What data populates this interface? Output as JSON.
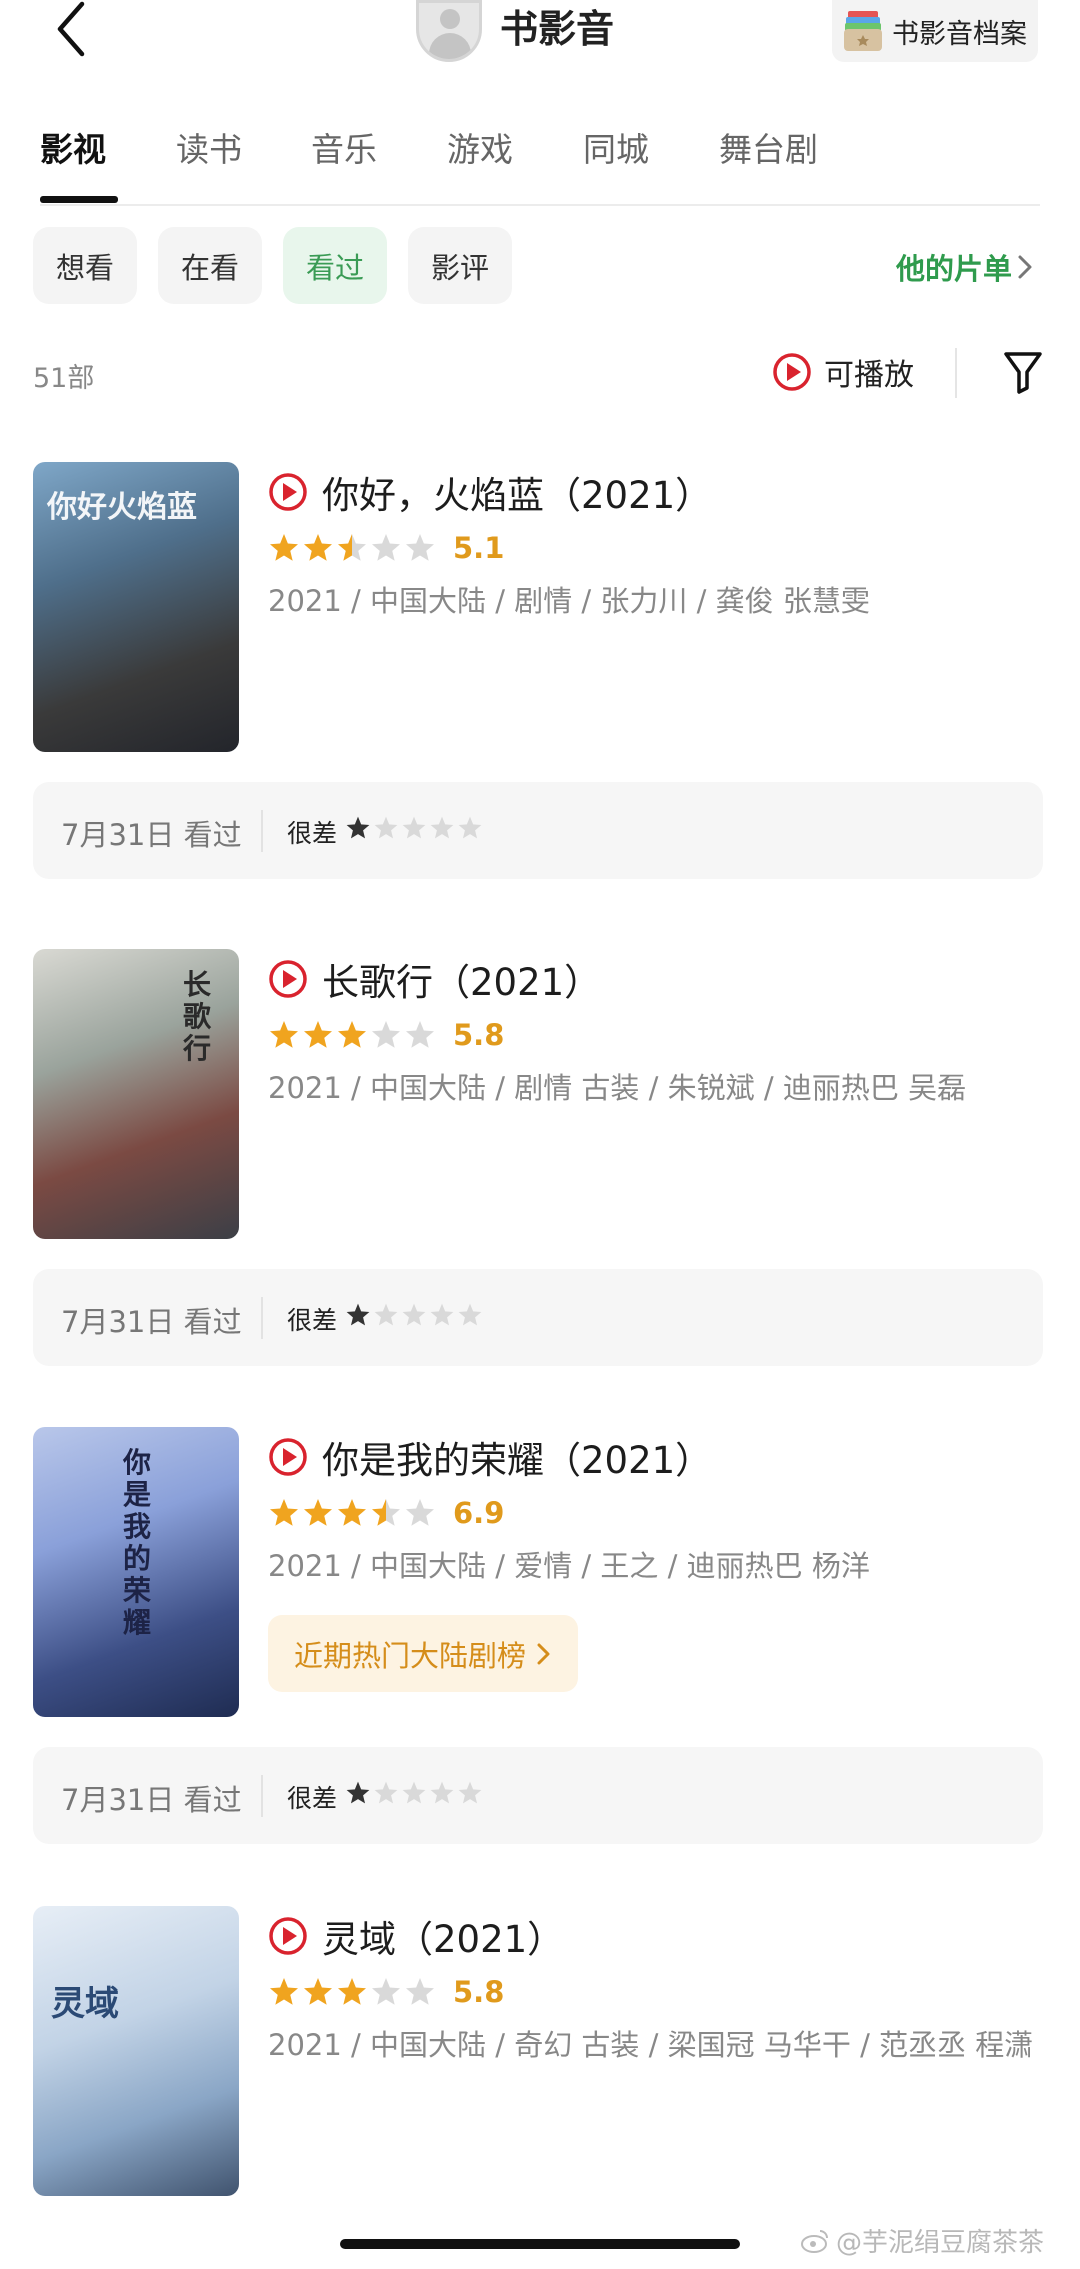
{
  "header": {
    "title": "书影音",
    "archive_label": "书影音档案"
  },
  "tabs": [
    {
      "label": "影视",
      "active": true
    },
    {
      "label": "读书",
      "active": false
    },
    {
      "label": "音乐",
      "active": false
    },
    {
      "label": "游戏",
      "active": false
    },
    {
      "label": "同城",
      "active": false
    },
    {
      "label": "舞台剧",
      "active": false
    }
  ],
  "filters": [
    {
      "label": "想看",
      "active": false
    },
    {
      "label": "在看",
      "active": false
    },
    {
      "label": "看过",
      "active": true
    },
    {
      "label": "影评",
      "active": false
    }
  ],
  "my_list_label": "他的片单",
  "count_label": "51部",
  "playable_label": "可播放",
  "colors": {
    "accent_green": "#2f9b4d",
    "star_gold": "#f0a41f",
    "play_red": "#d9232e",
    "hot_badge": "#d58d1a"
  },
  "items": [
    {
      "title": "你好，火焰蓝（2021）",
      "poster_text": "你好火焰蓝",
      "rating": 5.1,
      "rating_label": "5.1",
      "stars": 2.5,
      "meta": "2021 / 中国大陆 / 剧情 / 张力川 / 龚俊 张慧雯",
      "hot_badge": "",
      "review_date": "7月31日 看过",
      "review_verdict": "很差",
      "my_stars": 1
    },
    {
      "title": "长歌行（2021）",
      "poster_text": "长歌行",
      "rating": 5.8,
      "rating_label": "5.8",
      "stars": 3,
      "meta": "2021 / 中国大陆 / 剧情 古装 / 朱锐斌 / 迪丽热巴 吴磊",
      "hot_badge": "",
      "review_date": "7月31日 看过",
      "review_verdict": "很差",
      "my_stars": 1
    },
    {
      "title": "你是我的荣耀（2021）",
      "poster_text": "你是我的荣耀",
      "rating": 6.9,
      "rating_label": "6.9",
      "stars": 3.5,
      "meta": "2021 / 中国大陆 / 爱情 / 王之 / 迪丽热巴 杨洋",
      "hot_badge": "近期热门大陆剧榜",
      "review_date": "7月31日 看过",
      "review_verdict": "很差",
      "my_stars": 1
    },
    {
      "title": "灵域（2021）",
      "poster_text": "灵域",
      "rating": 5.8,
      "rating_label": "5.8",
      "stars": 3,
      "meta": "2021 / 中国大陆 / 奇幻 古装 / 梁国冠 马华干 / 范丞丞 程潇",
      "hot_badge": "",
      "review_date": "",
      "review_verdict": "",
      "my_stars": 0
    }
  ],
  "watermark": "@芋泥绢豆腐茶茶"
}
